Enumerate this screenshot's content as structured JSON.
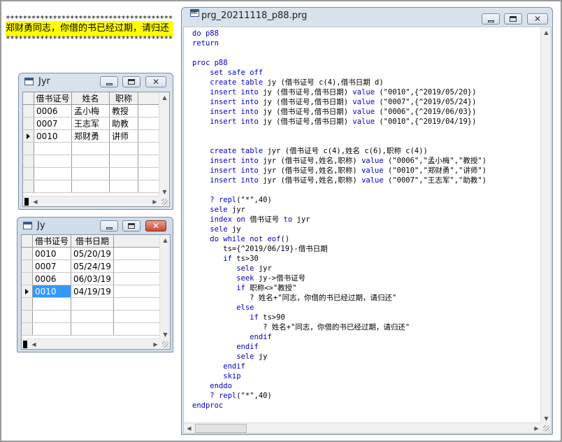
{
  "output": {
    "stars_top": "****************************************",
    "message": "郑财勇同志，你借的书已经过期，请归还",
    "stars_bottom": "****************************************"
  },
  "jyr_window": {
    "title": "Jyr",
    "columns": [
      "借书证号",
      "姓名",
      "职称"
    ],
    "rows": [
      {
        "id": "0006",
        "name": "孟小梅",
        "title": "教授"
      },
      {
        "id": "0007",
        "name": "王志军",
        "title": "助教"
      },
      {
        "id": "0010",
        "name": "郑财勇",
        "title": "讲师"
      }
    ],
    "current_row": 2
  },
  "jy_window": {
    "title": "Jy",
    "columns": [
      "借书证号",
      "借书日期"
    ],
    "rows": [
      {
        "id": "0010",
        "date": "05/20/19"
      },
      {
        "id": "0007",
        "date": "05/24/19"
      },
      {
        "id": "0006",
        "date": "06/03/19"
      },
      {
        "id": "0010",
        "date": "04/19/19"
      }
    ],
    "current_row": 3
  },
  "editor_window": {
    "title": "prg_20211118_p88.prg",
    "lines": [
      [
        {
          "t": "do p88",
          "k": true
        }
      ],
      [
        {
          "t": "return",
          "k": true
        }
      ],
      [],
      [
        {
          "t": "proc p88",
          "k": true
        }
      ],
      [
        {
          "t": "    "
        },
        {
          "t": "set safe off",
          "k": true
        }
      ],
      [
        {
          "t": "    "
        },
        {
          "t": "create table",
          "k": true
        },
        {
          "t": " jy (借书证号 c(4),借书日期 d)"
        }
      ],
      [
        {
          "t": "    "
        },
        {
          "t": "insert into",
          "k": true
        },
        {
          "t": " jy (借书证号,借书日期) "
        },
        {
          "t": "value",
          "k": true
        },
        {
          "t": " (\"0010\",{^2019/05/20})"
        }
      ],
      [
        {
          "t": "    "
        },
        {
          "t": "insert into",
          "k": true
        },
        {
          "t": " jy (借书证号,借书日期) "
        },
        {
          "t": "value",
          "k": true
        },
        {
          "t": " (\"0007\",{^2019/05/24})"
        }
      ],
      [
        {
          "t": "    "
        },
        {
          "t": "insert into",
          "k": true
        },
        {
          "t": " jy (借书证号,借书日期) "
        },
        {
          "t": "value",
          "k": true
        },
        {
          "t": " (\"0006\",{^2019/06/03})"
        }
      ],
      [
        {
          "t": "    "
        },
        {
          "t": "insert into",
          "k": true
        },
        {
          "t": " jy (借书证号,借书日期) "
        },
        {
          "t": "value",
          "k": true
        },
        {
          "t": " (\"0010\",{^2019/04/19})"
        }
      ],
      [],
      [],
      [
        {
          "t": "    "
        },
        {
          "t": "create table",
          "k": true
        },
        {
          "t": " jyr (借书证号 c(4),姓名 c(6),职称 c(4))"
        }
      ],
      [
        {
          "t": "    "
        },
        {
          "t": "insert into",
          "k": true
        },
        {
          "t": " jyr (借书证号,姓名,职称) "
        },
        {
          "t": "value",
          "k": true
        },
        {
          "t": " (\"0006\",\"孟小梅\",\"教授\")"
        }
      ],
      [
        {
          "t": "    "
        },
        {
          "t": "insert into",
          "k": true
        },
        {
          "t": " jyr (借书证号,姓名,职称) "
        },
        {
          "t": "value",
          "k": true
        },
        {
          "t": " (\"0010\",\"郑财勇\",\"讲师\")"
        }
      ],
      [
        {
          "t": "    "
        },
        {
          "t": "insert into",
          "k": true
        },
        {
          "t": " jyr (借书证号,姓名,职称) "
        },
        {
          "t": "value",
          "k": true
        },
        {
          "t": " (\"0007\",\"王志军\",\"助教\")"
        }
      ],
      [],
      [
        {
          "t": "    "
        },
        {
          "t": "? repl",
          "k": true
        },
        {
          "t": "(\"*\",40)"
        }
      ],
      [
        {
          "t": "    "
        },
        {
          "t": "sele",
          "k": true
        },
        {
          "t": " jyr"
        }
      ],
      [
        {
          "t": "    "
        },
        {
          "t": "index on",
          "k": true
        },
        {
          "t": " 借书证号 "
        },
        {
          "t": "to",
          "k": true
        },
        {
          "t": " jyr"
        }
      ],
      [
        {
          "t": "    "
        },
        {
          "t": "sele",
          "k": true
        },
        {
          "t": " jy"
        }
      ],
      [
        {
          "t": "    "
        },
        {
          "t": "do while not eof",
          "k": true
        },
        {
          "t": "()"
        }
      ],
      [
        {
          "t": "       ts={^2019/06/19}-借书日期"
        }
      ],
      [
        {
          "t": "       "
        },
        {
          "t": "if",
          "k": true
        },
        {
          "t": " ts>30"
        }
      ],
      [
        {
          "t": "          "
        },
        {
          "t": "sele",
          "k": true
        },
        {
          "t": " jyr"
        }
      ],
      [
        {
          "t": "          "
        },
        {
          "t": "seek",
          "k": true
        },
        {
          "t": " jy->借书证号"
        }
      ],
      [
        {
          "t": "          "
        },
        {
          "t": "if",
          "k": true
        },
        {
          "t": " 职称<>\"教授\""
        }
      ],
      [
        {
          "t": "             ? 姓名+\"同志，你借的书已经过期，请归还\""
        }
      ],
      [
        {
          "t": "          "
        },
        {
          "t": "else",
          "k": true
        }
      ],
      [
        {
          "t": "             "
        },
        {
          "t": "if",
          "k": true
        },
        {
          "t": " ts>90"
        }
      ],
      [
        {
          "t": "                ? 姓名+\"同志，你借的书已经过期，请归还\""
        }
      ],
      [
        {
          "t": "             "
        },
        {
          "t": "endif",
          "k": true
        }
      ],
      [
        {
          "t": "          "
        },
        {
          "t": "endif",
          "k": true
        }
      ],
      [
        {
          "t": "          "
        },
        {
          "t": "sele",
          "k": true
        },
        {
          "t": " jy"
        }
      ],
      [
        {
          "t": "       "
        },
        {
          "t": "endif",
          "k": true
        }
      ],
      [
        {
          "t": "       "
        },
        {
          "t": "skip",
          "k": true
        }
      ],
      [
        {
          "t": "    "
        },
        {
          "t": "enddo",
          "k": true
        }
      ],
      [
        {
          "t": "    "
        },
        {
          "t": "? repl",
          "k": true
        },
        {
          "t": "(\"*\",40)"
        }
      ],
      [
        {
          "t": "endproc",
          "k": true
        }
      ]
    ]
  },
  "colors": {
    "keyword": "#0000cc",
    "highlight": "#ffff00",
    "selection": "#3399ff",
    "close_button": "#c74b32"
  }
}
